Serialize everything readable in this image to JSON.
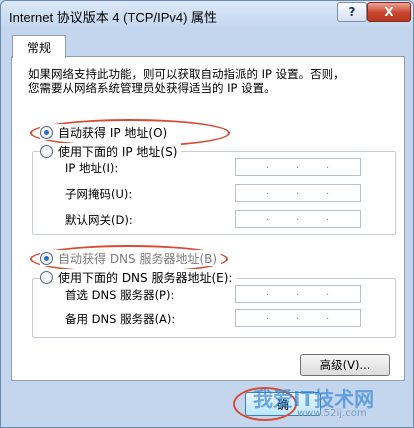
{
  "window": {
    "title": "Internet 协议版本 4 (TCP/IPv4) 属性"
  },
  "titlebar": {
    "help_label": "?",
    "close_label": "X"
  },
  "tab": {
    "label": "常规"
  },
  "intro": {
    "line1": "如果网络支持此功能，则可以获取自动指派的 IP 设置。否则，",
    "line2": "您需要从网络系统管理员处获得适当的 IP 设置。"
  },
  "ip": {
    "auto_label": "自动获得 IP 地址(O)",
    "manual_label": "使用下面的 IP 地址(S)",
    "selected": "auto",
    "fields": [
      {
        "label": "IP 地址(I):"
      },
      {
        "label": "子网掩码(U):"
      },
      {
        "label": "默认网关(D):"
      }
    ]
  },
  "dns": {
    "auto_label": "自动获得 DNS 服务器地址(B)",
    "manual_label": "使用下面的 DNS 服务器地址(E):",
    "selected": "auto",
    "fields": [
      {
        "label": "首选 DNS 服务器(P):"
      },
      {
        "label": "备用 DNS 服务器(A):"
      }
    ]
  },
  "ip_dot": ".",
  "buttons": {
    "advanced_label": "高级(V)...",
    "ok_label": "确"
  },
  "watermark": {
    "text": "我爱IT技术网",
    "url": "www.52ij.com"
  },
  "colors": {
    "highlight": "#d74b32",
    "radio_selected": "#2d6ec9"
  }
}
